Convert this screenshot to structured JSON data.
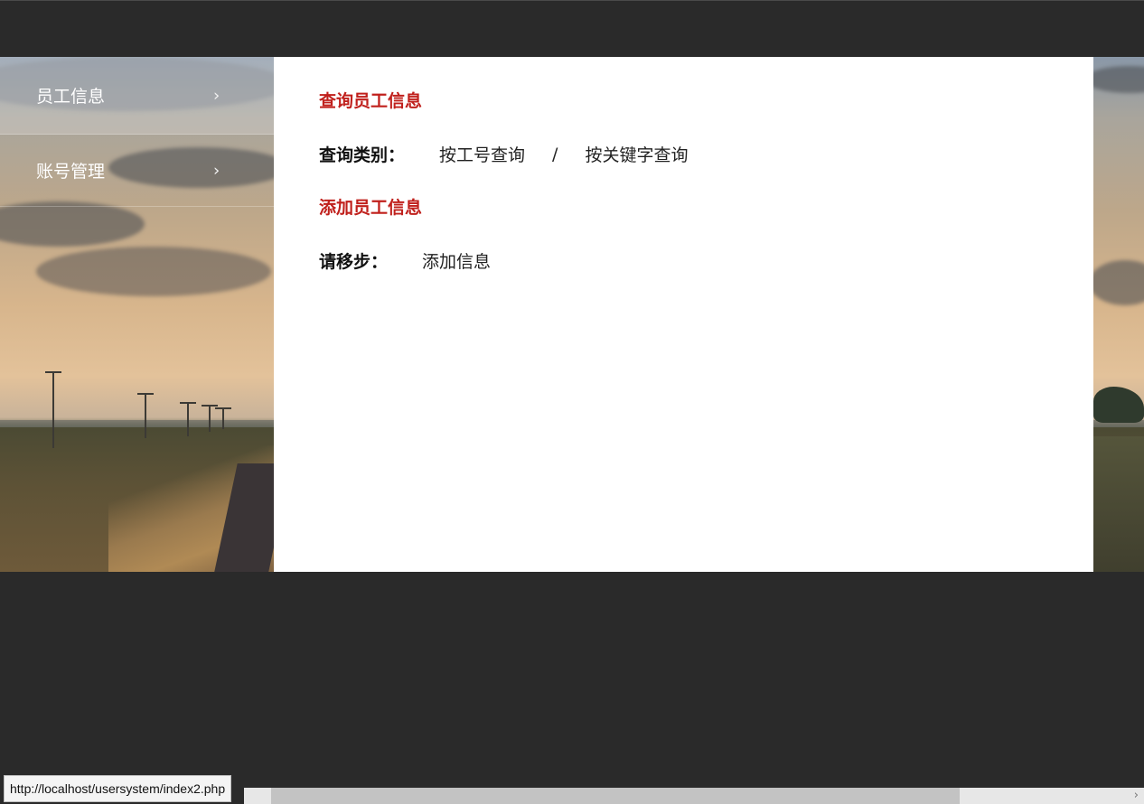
{
  "sidebar": {
    "items": [
      {
        "label": "员工信息",
        "icon": "chevron-right-icon"
      },
      {
        "label": "账号管理",
        "icon": "chevron-right-icon"
      }
    ]
  },
  "main": {
    "query_section": {
      "title": "查询员工信息",
      "label": "查询类别：",
      "option_by_id": "按工号查询",
      "separator": "/",
      "option_by_keyword": "按关键字查询"
    },
    "add_section": {
      "title": "添加员工信息",
      "label": "请移步：",
      "link": "添加信息"
    }
  },
  "status_bar": {
    "url": "http://localhost/usersystem/index2.php"
  },
  "colors": {
    "accent_red": "#c0201c",
    "background_dark": "#2a2a2a",
    "panel": "#ffffff"
  }
}
